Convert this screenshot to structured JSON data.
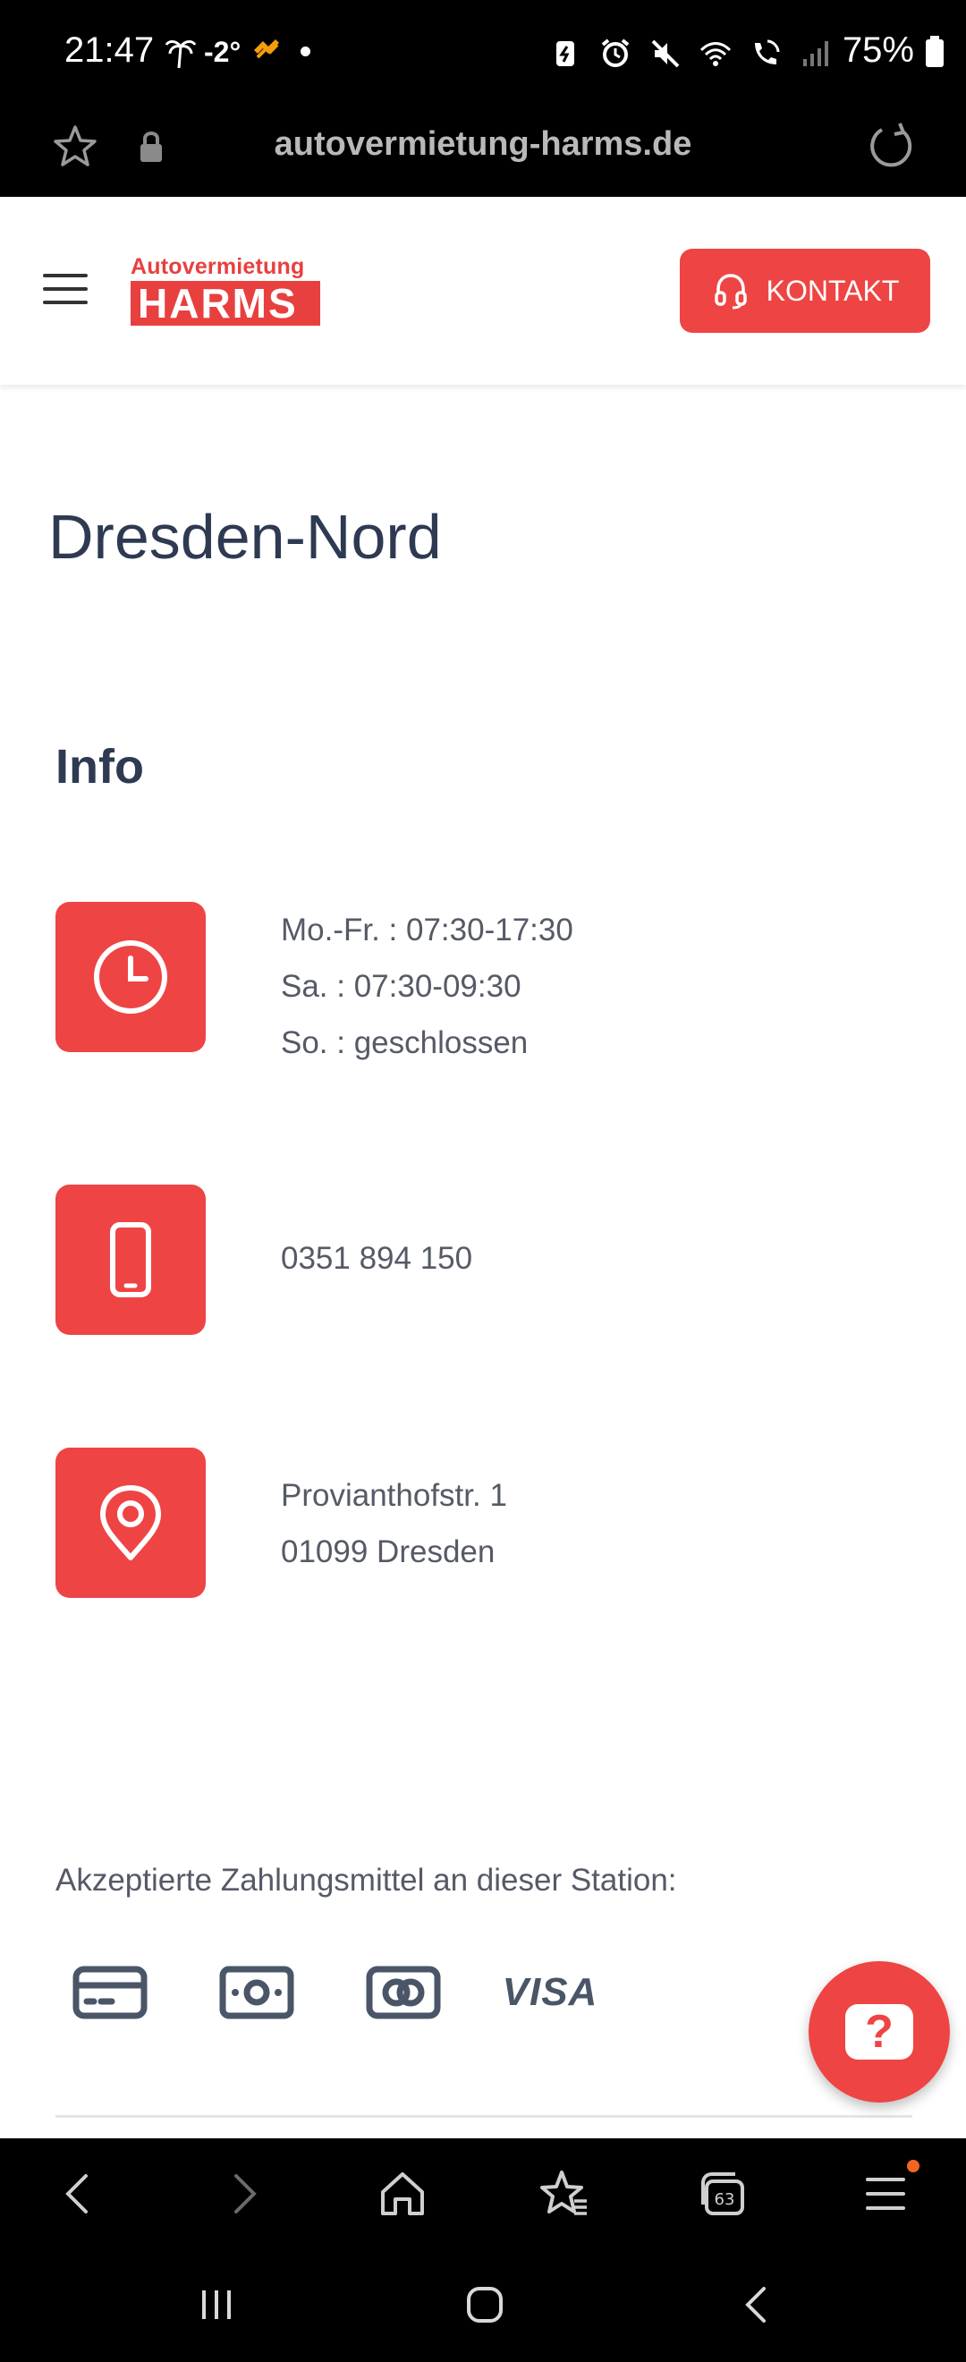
{
  "status_bar": {
    "time": "21:47",
    "temperature": "-2°",
    "battery": "75%",
    "weather_icon": "palm-tree-icon",
    "icons": [
      "battery-saver-icon",
      "alarm-icon",
      "mute-icon",
      "wifi-icon",
      "wifi-calling-icon",
      "signal-icon"
    ]
  },
  "browser": {
    "url": "autovermietung-harms.de",
    "bottom_icons": [
      "back-icon",
      "forward-icon",
      "home-icon",
      "bookmarks-icon",
      "tabs-icon",
      "menu-icon"
    ],
    "tabs_count": "63"
  },
  "header": {
    "logo_top": "Autovermietung",
    "logo_bottom": "HARMS",
    "contact_label": "KONTAKT"
  },
  "page": {
    "title": "Dresden-Nord",
    "info_heading": "Info",
    "hours": {
      "line1": "Mo.-Fr. : 07:30-17:30",
      "line2": "Sa. : 07:30-09:30",
      "line3": "So. : geschlossen"
    },
    "phone": "0351 894 150",
    "address": {
      "line1": "Provianthofstr. 1",
      "line2": "01099 Dresden"
    },
    "payment_heading": "Akzeptierte Zahlungsmittel an dieser Station:",
    "payment_methods": [
      "card-icon",
      "cash-icon",
      "mastercard-icon",
      "VISA"
    ],
    "help_label": "?"
  },
  "colors": {
    "accent": "#ef4444",
    "text_dark": "#2e3a52",
    "text_body": "#555a66"
  }
}
